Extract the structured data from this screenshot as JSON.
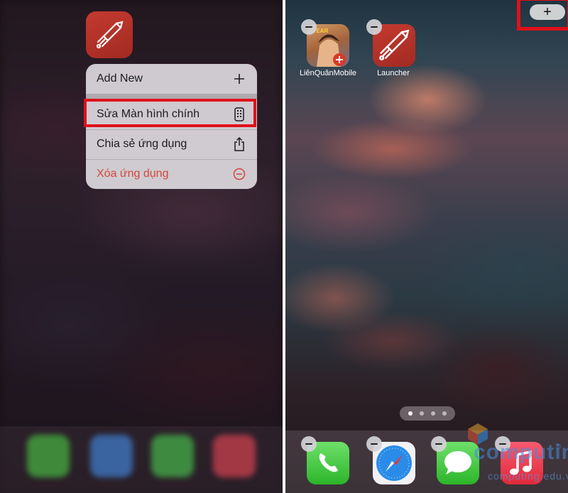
{
  "context_menu": {
    "add_new": "Add New",
    "edit_home_screen": "Sửa Màn hình chính",
    "share_app": "Chia sẻ ứng dụng",
    "delete_app": "Xóa ứng dụng",
    "delete_color": "#d3473c"
  },
  "home_screen": {
    "apps": [
      {
        "label": "LiênQuânMobile",
        "icon": "game-icon"
      },
      {
        "label": "Launcher",
        "icon": "rocket-icon"
      }
    ],
    "add_widget_symbol": "+",
    "dock": [
      {
        "icon": "phone-icon"
      },
      {
        "icon": "safari-icon"
      },
      {
        "icon": "messages-icon"
      },
      {
        "icon": "music-icon"
      }
    ],
    "page_dots": 4
  },
  "highlight_color": "#e0101a",
  "watermark": {
    "brand": "computing",
    "site": "computing.edu.vn",
    "registered": "®"
  }
}
